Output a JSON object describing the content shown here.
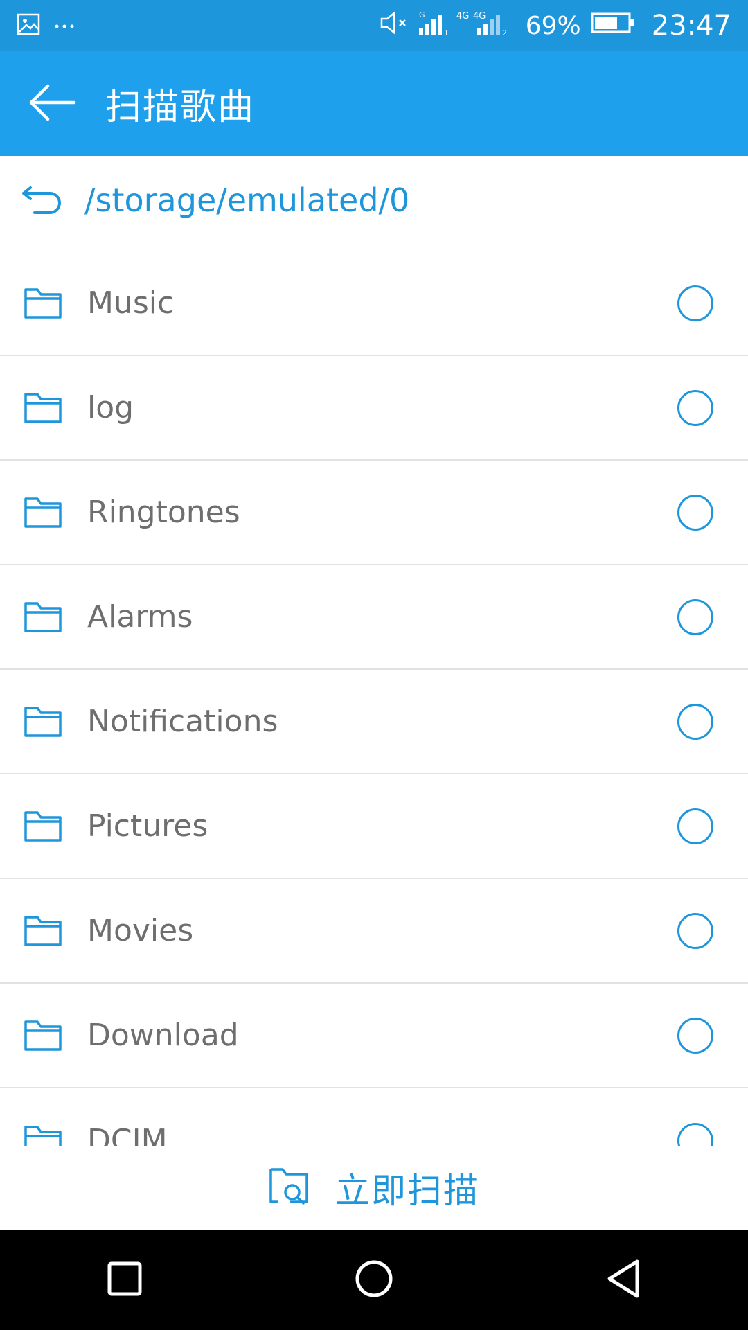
{
  "status_bar": {
    "battery_percent": "69%",
    "time": "23:47",
    "icons": [
      "gallery-icon",
      "more-icon",
      "mute-icon",
      "signal-icon",
      "battery-icon"
    ]
  },
  "app_bar": {
    "title": "扫描歌曲"
  },
  "path": {
    "current": "/storage/emulated/0"
  },
  "folders": [
    {
      "name": "Music"
    },
    {
      "name": "log"
    },
    {
      "name": "Ringtones"
    },
    {
      "name": "Alarms"
    },
    {
      "name": "Notifications"
    },
    {
      "name": "Pictures"
    },
    {
      "name": "Movies"
    },
    {
      "name": "Download"
    },
    {
      "name": "DCIM"
    }
  ],
  "scan_button": {
    "label": "立即扫描"
  },
  "colors": {
    "accent": "#1e96dc",
    "app_bar": "#1fa0ec",
    "text": "#6e6e6e"
  }
}
